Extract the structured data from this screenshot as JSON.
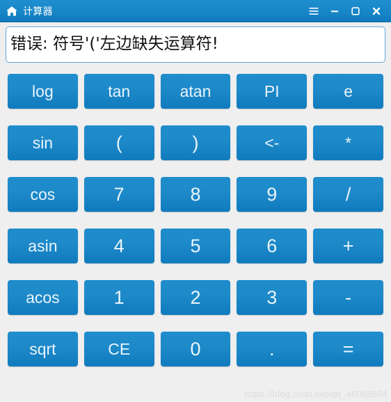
{
  "window": {
    "title": "计算器",
    "home_icon": "home-icon",
    "accent_color": "#1787c8",
    "titlebar_gradient_top": "#1f8fd0",
    "titlebar_gradient_bottom": "#1079bd"
  },
  "titlebar_controls": [
    {
      "name": "menu-button",
      "icon": "hamburger-menu-icon",
      "label": "菜单"
    },
    {
      "name": "minimize-button",
      "icon": "minimize-icon",
      "label": "最小化"
    },
    {
      "name": "maximize-button",
      "icon": "maximize-icon",
      "label": "最大化"
    },
    {
      "name": "close-button",
      "icon": "close-icon",
      "label": "关闭"
    }
  ],
  "display": {
    "value": "错误: 符号'('左边缺失运算符!",
    "placeholder": "",
    "text_color": "#111111",
    "border_color": "#5fa8e0",
    "background": "#ffffff"
  },
  "keypad": {
    "button_color_top": "#1f8ccc",
    "button_color_bottom": "#0f7bbe",
    "button_text_color": "#eaf4fb",
    "rows": [
      [
        {
          "label": "log",
          "name": "key-log",
          "size": "small"
        },
        {
          "label": "tan",
          "name": "key-tan",
          "size": "small"
        },
        {
          "label": "atan",
          "name": "key-atan",
          "size": "small"
        },
        {
          "label": "PI",
          "name": "key-pi",
          "size": "small"
        },
        {
          "label": "e",
          "name": "key-e",
          "size": "small"
        }
      ],
      [
        {
          "label": "sin",
          "name": "key-sin",
          "size": "small"
        },
        {
          "label": "(",
          "name": "key-left-paren",
          "size": "normal"
        },
        {
          "label": ")",
          "name": "key-right-paren",
          "size": "normal"
        },
        {
          "label": "<-",
          "name": "key-backspace",
          "size": "small"
        },
        {
          "label": "*",
          "name": "key-multiply",
          "size": "small"
        }
      ],
      [
        {
          "label": "cos",
          "name": "key-cos",
          "size": "small"
        },
        {
          "label": "7",
          "name": "key-7",
          "size": "normal"
        },
        {
          "label": "8",
          "name": "key-8",
          "size": "normal"
        },
        {
          "label": "9",
          "name": "key-9",
          "size": "normal"
        },
        {
          "label": "/",
          "name": "key-divide",
          "size": "normal"
        }
      ],
      [
        {
          "label": "asin",
          "name": "key-asin",
          "size": "small"
        },
        {
          "label": "4",
          "name": "key-4",
          "size": "normal"
        },
        {
          "label": "5",
          "name": "key-5",
          "size": "normal"
        },
        {
          "label": "6",
          "name": "key-6",
          "size": "normal"
        },
        {
          "label": "+",
          "name": "key-plus",
          "size": "normal"
        }
      ],
      [
        {
          "label": "acos",
          "name": "key-acos",
          "size": "small"
        },
        {
          "label": "1",
          "name": "key-1",
          "size": "normal"
        },
        {
          "label": "2",
          "name": "key-2",
          "size": "normal"
        },
        {
          "label": "3",
          "name": "key-3",
          "size": "normal"
        },
        {
          "label": "-",
          "name": "key-minus",
          "size": "normal"
        }
      ],
      [
        {
          "label": "sqrt",
          "name": "key-sqrt",
          "size": "small"
        },
        {
          "label": "CE",
          "name": "key-clear",
          "size": "small"
        },
        {
          "label": "0",
          "name": "key-0",
          "size": "normal"
        },
        {
          "label": ".",
          "name": "key-decimal",
          "size": "normal"
        },
        {
          "label": "=",
          "name": "key-equals",
          "size": "normal"
        }
      ]
    ]
  },
  "watermark": {
    "text": "https://blog.csdn.net/qq_46068864"
  }
}
